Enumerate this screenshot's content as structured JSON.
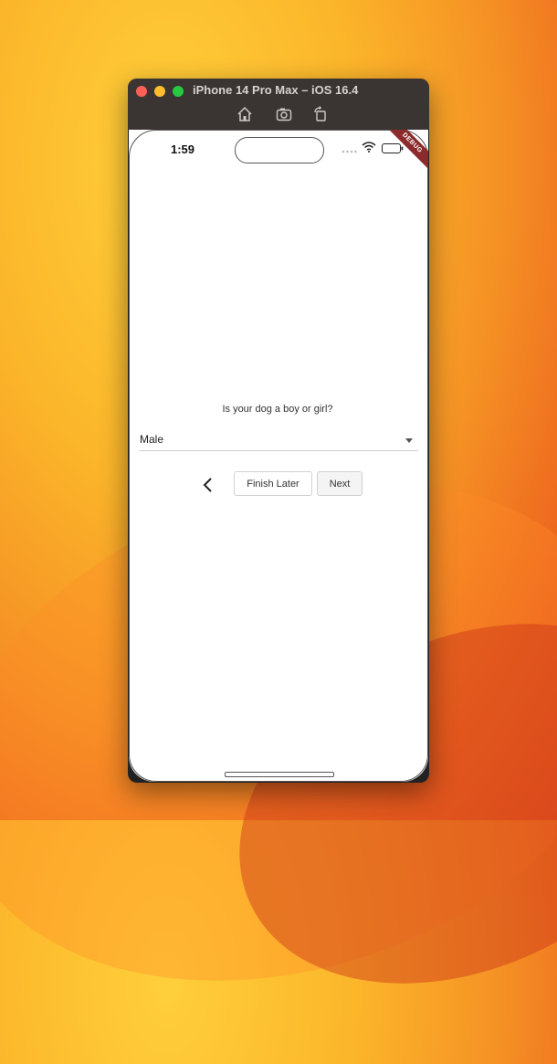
{
  "window": {
    "title": "iPhone 14 Pro Max – iOS 16.4"
  },
  "toolbar": {
    "icons": [
      "home-icon",
      "camera-icon",
      "rotate-icon"
    ]
  },
  "status_bar": {
    "time": "1:59"
  },
  "debug_banner": "DEBUG",
  "form": {
    "question": "Is your dog a boy or girl?",
    "gender_select": {
      "selected": "Male"
    },
    "finish_later_label": "Finish Later",
    "next_label": "Next"
  },
  "colors": {
    "debug_banner": "#8b2b2b",
    "title_bar": "#3a3533"
  }
}
